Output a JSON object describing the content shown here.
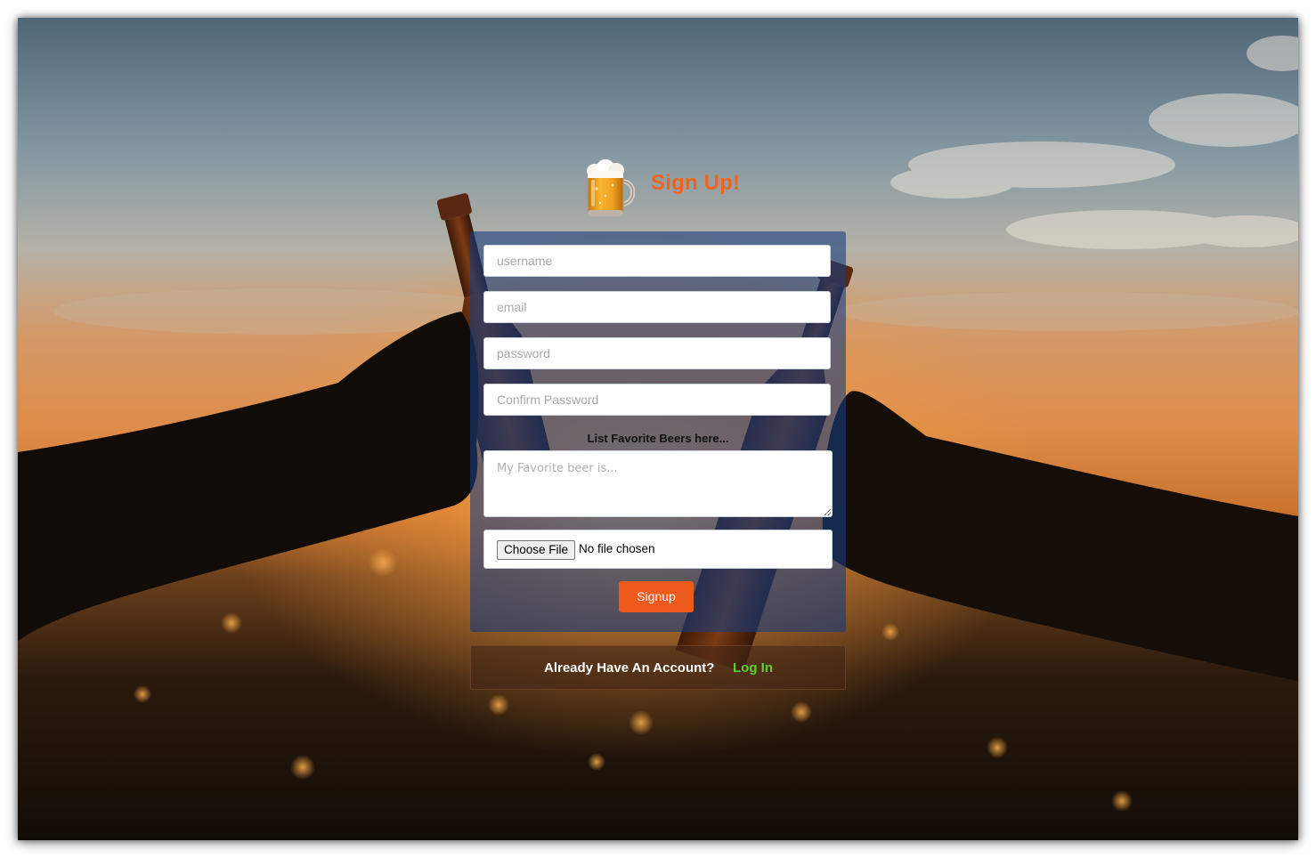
{
  "page": {
    "title": "Sign Up!",
    "accent_color": "#f2641e",
    "logo_icon": "beer-mug-icon"
  },
  "form": {
    "username_placeholder": "username",
    "email_placeholder": "email",
    "password_placeholder": "password",
    "confirm_password_placeholder": "Confirm Password",
    "favorites_label": "List Favorite Beers here...",
    "favorites_placeholder": "My Favorite beer is...",
    "file_button_label": "Choose File",
    "file_status": "No file chosen",
    "submit_label": "Signup",
    "submit_color": "#ee5a1c"
  },
  "login": {
    "prompt": "Already Have An Account?",
    "link_label": "Log In",
    "link_color": "#5cd12b"
  }
}
